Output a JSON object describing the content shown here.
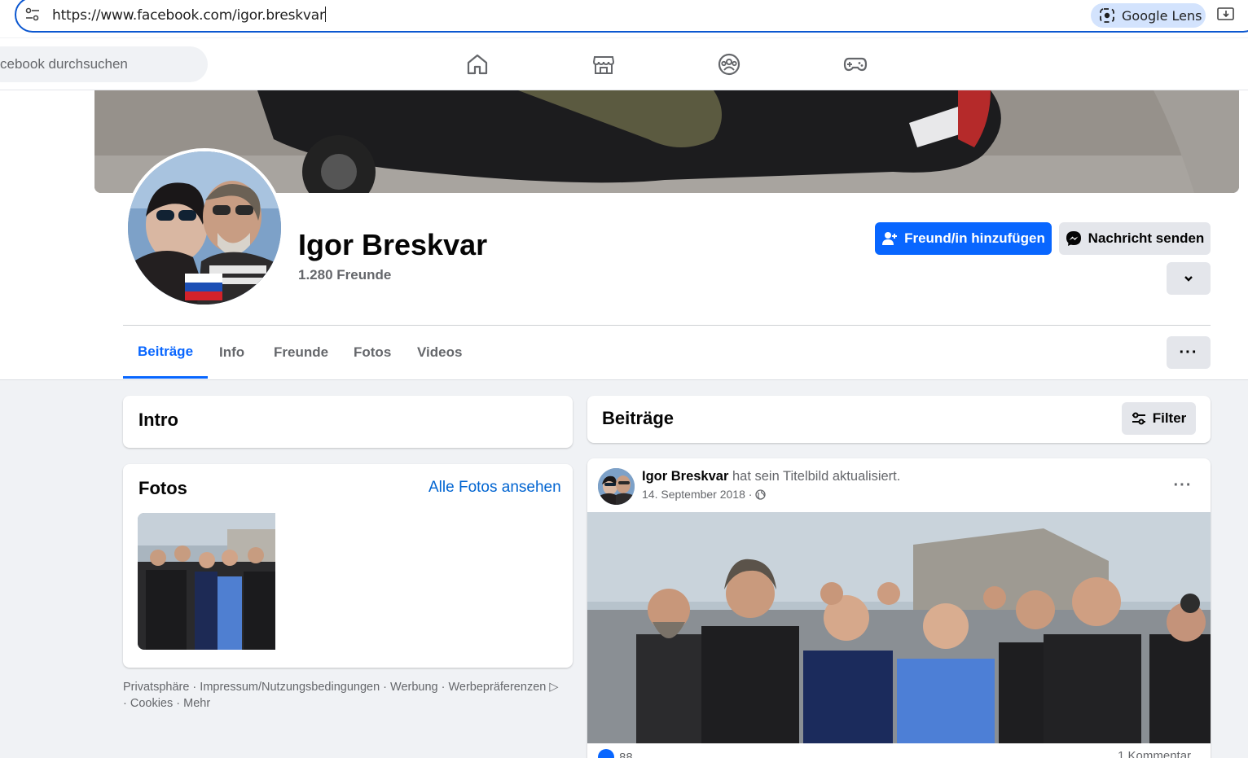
{
  "browser": {
    "url": "https://www.facebook.com/igor.breskvar",
    "lens_label": "Google Lens"
  },
  "fb_nav": {
    "search_placeholder": "Facebook durchsuchen",
    "search_visible_text": "cebook durchsuchen",
    "icons": [
      "home-icon",
      "marketplace-icon",
      "groups-icon",
      "gaming-icon"
    ]
  },
  "profile": {
    "name": "Igor Breskvar",
    "friends": "1.280 Freunde",
    "add_friend_label": "Freund/in hinzufügen",
    "message_label": "Nachricht senden"
  },
  "tabs": [
    {
      "label": "Beiträge",
      "active": true
    },
    {
      "label": "Info",
      "active": false
    },
    {
      "label": "Freunde",
      "active": false
    },
    {
      "label": "Fotos",
      "active": false
    },
    {
      "label": "Videos",
      "active": false
    }
  ],
  "intro": {
    "title": "Intro"
  },
  "photos": {
    "title": "Fotos",
    "all_link": "Alle Fotos ansehen"
  },
  "footer": {
    "line1": "Privatsphäre · Impressum/Nutzungsbedingungen · Werbung · Werbepräferenzen ▷",
    "line2": "· Cookies · Mehr"
  },
  "posts_header": {
    "title": "Beiträge",
    "filter_label": "Filter"
  },
  "post": {
    "author": "Igor Breskvar",
    "action": " hat sein Titelbild aktualisiert.",
    "date": "14. September 2018 ·",
    "reactions": "88",
    "comments": "1 Kommentar"
  },
  "colors": {
    "accent": "#0866ff",
    "link": "#0064d1",
    "secondary_text": "#65676b",
    "button_gray": "#e4e6eb",
    "page_bg": "#f0f2f5"
  }
}
